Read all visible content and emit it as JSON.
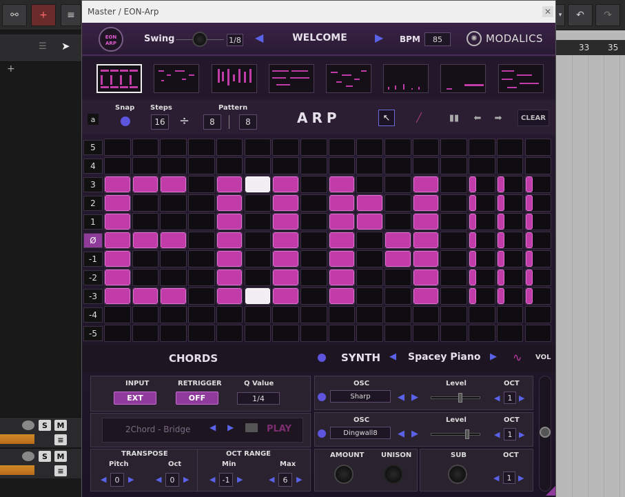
{
  "daw": {
    "ruler": {
      "bar1": "33",
      "bar2": "35"
    },
    "add_track": "+",
    "tracks": [
      {
        "s": "S",
        "m": "M"
      },
      {
        "s": "S",
        "m": "M"
      }
    ]
  },
  "window": {
    "title": "Master / EON-Arp",
    "close": "✕"
  },
  "header": {
    "logo_text": "EON ARP",
    "swing_label": "Swing",
    "swing_value": "1/8",
    "preset_name": "WELCOME",
    "bpm_label": "BPM",
    "bpm_value": "85",
    "brand": "MODALICS"
  },
  "arp": {
    "mode_letter": "a",
    "snap_label": "Snap",
    "steps_label": "Steps",
    "steps_value": "16",
    "divide_symbol": "÷",
    "steps_div": "8",
    "pattern_label": "Pattern",
    "pattern_value": "8",
    "title": "ARP",
    "clear_label": "CLEAR"
  },
  "grid": {
    "row_labels": [
      "5",
      "4",
      "3",
      "2",
      "1",
      "Ø",
      "-1",
      "-2",
      "-3",
      "-4",
      "-5"
    ],
    "columns": 16,
    "active_cells": [
      [
        2,
        0
      ],
      [
        2,
        1
      ],
      [
        2,
        2
      ],
      [
        2,
        4
      ],
      [
        2,
        5
      ],
      [
        2,
        6
      ],
      [
        2,
        8
      ],
      [
        2,
        11
      ],
      [
        2,
        13
      ],
      [
        2,
        14
      ],
      [
        2,
        15
      ],
      [
        3,
        0
      ],
      [
        3,
        4
      ],
      [
        3,
        6
      ],
      [
        3,
        8
      ],
      [
        3,
        9
      ],
      [
        3,
        11
      ],
      [
        3,
        13
      ],
      [
        3,
        14
      ],
      [
        3,
        15
      ],
      [
        4,
        0
      ],
      [
        4,
        4
      ],
      [
        4,
        6
      ],
      [
        4,
        8
      ],
      [
        4,
        9
      ],
      [
        4,
        11
      ],
      [
        4,
        13
      ],
      [
        4,
        14
      ],
      [
        4,
        15
      ],
      [
        5,
        0
      ],
      [
        5,
        1
      ],
      [
        5,
        2
      ],
      [
        5,
        4
      ],
      [
        5,
        6
      ],
      [
        5,
        8
      ],
      [
        5,
        10
      ],
      [
        5,
        11
      ],
      [
        5,
        13
      ],
      [
        5,
        14
      ],
      [
        5,
        15
      ],
      [
        6,
        0
      ],
      [
        6,
        4
      ],
      [
        6,
        6
      ],
      [
        6,
        8
      ],
      [
        6,
        10
      ],
      [
        6,
        11
      ],
      [
        6,
        13
      ],
      [
        6,
        14
      ],
      [
        6,
        15
      ],
      [
        7,
        0
      ],
      [
        7,
        4
      ],
      [
        7,
        6
      ],
      [
        7,
        8
      ],
      [
        7,
        11
      ],
      [
        7,
        13
      ],
      [
        7,
        14
      ],
      [
        7,
        15
      ],
      [
        8,
        0
      ],
      [
        8,
        1
      ],
      [
        8,
        2
      ],
      [
        8,
        4
      ],
      [
        8,
        5
      ],
      [
        8,
        6
      ],
      [
        8,
        8
      ],
      [
        8,
        11
      ],
      [
        8,
        13
      ],
      [
        8,
        14
      ],
      [
        8,
        15
      ]
    ],
    "highlighted_cells": [
      [
        2,
        5
      ],
      [
        8,
        5
      ]
    ],
    "narrow_columns": [
      13,
      14,
      15
    ]
  },
  "strip": {
    "chords_label": "CHORDS",
    "synth_label": "SYNTH",
    "synth_preset": "Spacey Piano",
    "vol_label": "VOL"
  },
  "chords": {
    "input_label": "INPUT",
    "input_value": "EXT",
    "retrigger_label": "RETRIGGER",
    "retrigger_value": "OFF",
    "qvalue_label": "Q Value",
    "qvalue_value": "1/4",
    "chord_preset": "2Chord - Bridge",
    "play_label": "PLAY",
    "transpose_label": "TRANSPOSE",
    "pitch_label": "Pitch",
    "pitch_value": "0",
    "oct_label": "Oct",
    "oct_value": "0",
    "oct_range_label": "OCT RANGE",
    "min_label": "Min",
    "min_value": "-1",
    "max_label": "Max",
    "max_value": "6"
  },
  "synth": {
    "osc1_label": "OSC",
    "osc1_wave": "Sharp",
    "osc1_level_label": "Level",
    "osc1_level": 0.6,
    "osc1_oct_label": "OCT",
    "osc1_oct": "1",
    "osc2_label": "OSC",
    "osc2_wave": "Dingwall8",
    "osc2_level_label": "Level",
    "osc2_level": 0.75,
    "osc2_oct_label": "OCT",
    "osc2_oct": "1",
    "amount_label": "AMOUNT",
    "unison_label": "UNISON",
    "sub_label": "SUB",
    "sub_oct_label": "OCT",
    "sub_oct": "1"
  }
}
